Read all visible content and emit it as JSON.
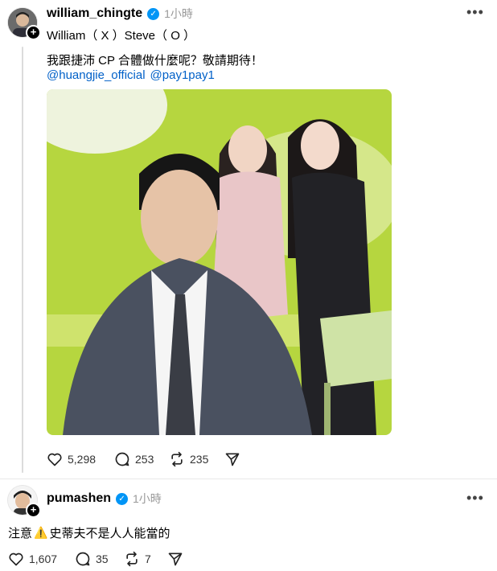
{
  "post1": {
    "username": "william_chingte",
    "time": "1小時",
    "line1": "William（ X ）Steve（ O ）",
    "line2": "我跟捷沛 CP 合體做什麼呢？敬請期待！",
    "mention1": "@huangjie_official",
    "mention2": "@pay1pay1",
    "likes": "5,298",
    "comments": "253",
    "reposts": "235"
  },
  "post2": {
    "username": "pumashen",
    "time": "1小時",
    "text_before": "注意",
    "warning_glyph": "⚠️",
    "text_after": "史蒂夫不是人人能當的",
    "likes": "1,607",
    "comments": "35",
    "reposts": "7"
  },
  "icons": {
    "more": "more-icon",
    "verified": "verified-badge-icon",
    "like": "heart-icon",
    "comment": "comment-icon",
    "repost": "repost-icon",
    "share": "send-icon"
  },
  "colors": {
    "verified": "#0095f6",
    "mention": "#0060c8",
    "photo_background_green": "#b6d63f"
  }
}
